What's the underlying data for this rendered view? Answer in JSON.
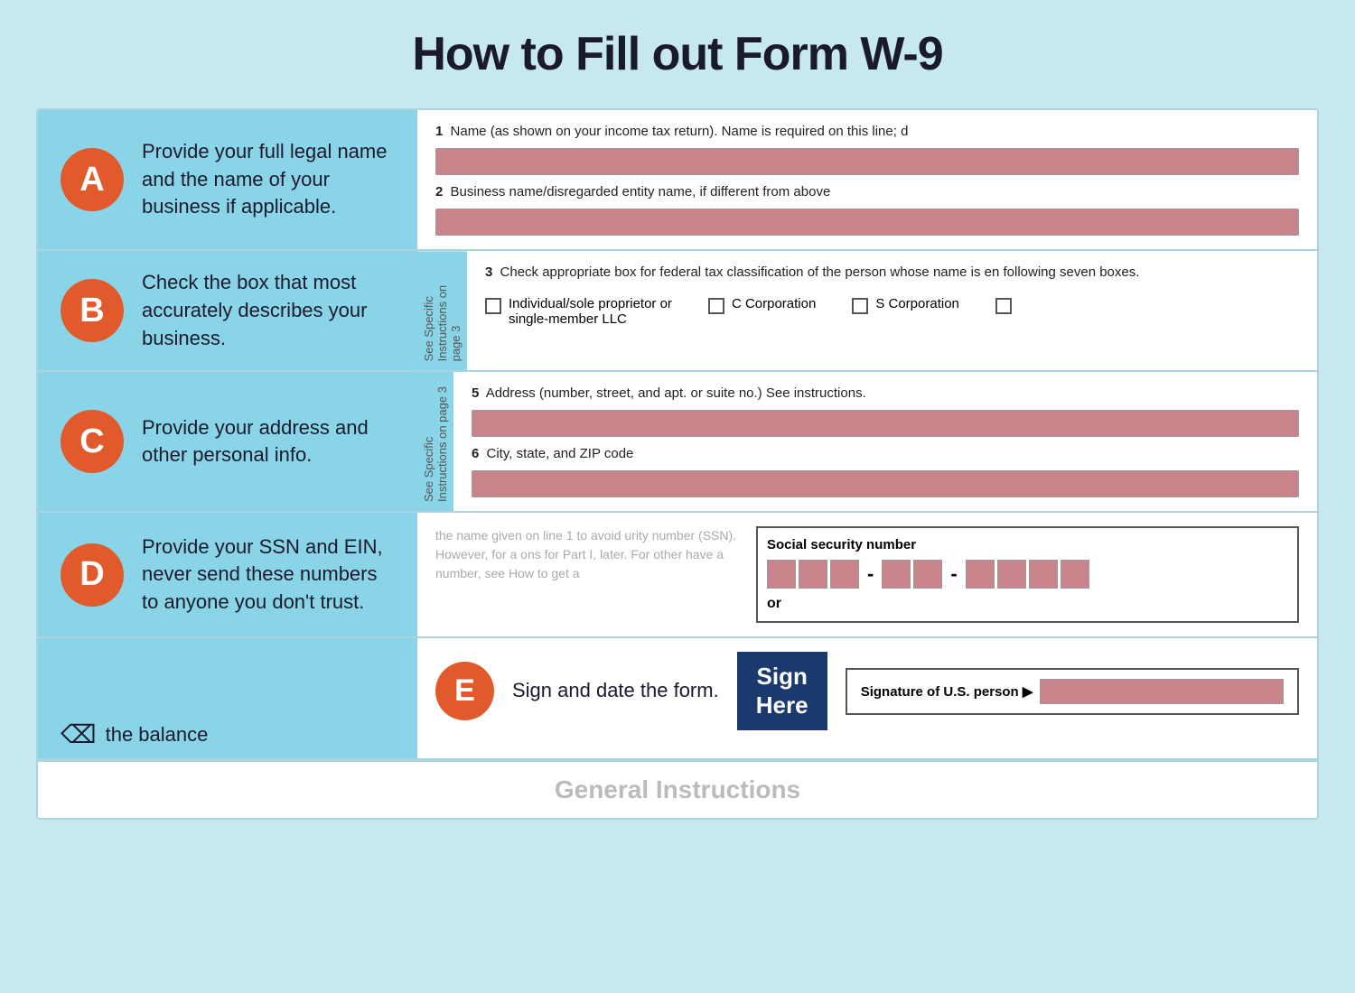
{
  "page": {
    "title": "How to Fill out Form W-9",
    "background_color": "#c8e8f0"
  },
  "sections": {
    "a": {
      "badge": "A",
      "description": "Provide your full legal name and the name of your business if applicable.",
      "field1_num": "1",
      "field1_label": "Name (as shown on your income tax return). Name is required on this line; d",
      "field2_num": "2",
      "field2_label": "Business name/disregarded entity name, if different from above"
    },
    "b": {
      "badge": "B",
      "description": "Check the box that most accurately describes your business.",
      "side_text": "See Specific Instructions on page 3",
      "field3_num": "3",
      "field3_label": "Check appropriate box for federal tax classification of the person whose name is en following seven boxes.",
      "checkboxes": [
        {
          "label": "Individual/sole proprietor or\nsingle-member LLC"
        },
        {
          "label": "C Corporation"
        },
        {
          "label": "S Corporation"
        }
      ]
    },
    "c": {
      "badge": "C",
      "description": "Provide your address and other personal info.",
      "side_text": "See Specific Instructions on page 3",
      "field5_num": "5",
      "field5_label": "Address (number, street, and apt. or suite no.) See instructions.",
      "field6_num": "6",
      "field6_label": "City, state, and ZIP code"
    },
    "d": {
      "badge": "D",
      "description": "Provide your SSN and EIN, never send these numbers to anyone you don't trust.",
      "ssn_hint": "the name given on line 1 to avoid urity number (SSN). However, for a ons for Part I, later. For other have a number, see How to get a",
      "ssn_label": "Social security number",
      "ssn_or": "or"
    },
    "e": {
      "badge": "E",
      "description": "Sign and date the form.",
      "sign_here_line1": "Sign",
      "sign_here_line2": "Here",
      "signature_label": "Signature of U.S. person ▶"
    }
  },
  "footer": {
    "logo_text": "the balance",
    "general_instructions": "General Instructions"
  }
}
